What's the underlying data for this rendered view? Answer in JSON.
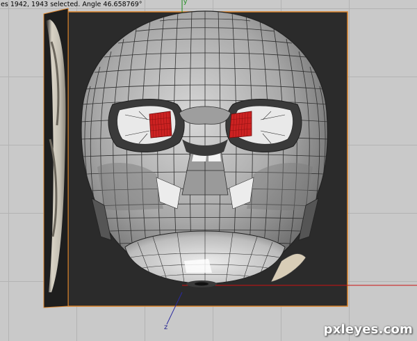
{
  "status": {
    "text": "es 1942, 1943 selected. Angle 46.658769°"
  },
  "axes": {
    "y_label": "y",
    "z_label": "z"
  },
  "watermark": {
    "text": "pxleyes.com"
  },
  "colors": {
    "viewport_bg": "#c9c9c9",
    "grid_line": "#b3b3b3",
    "backdrop": "#2b2b2b",
    "backdrop_border": "#d9822b",
    "eye_red": "#cc2222",
    "axis_red": "#cc1111",
    "axis_green": "#1a8a1a",
    "axis_blue": "#2a2aa0"
  },
  "icons": {
    "model": "helmet-mesh",
    "reference": "side-reference-image"
  }
}
